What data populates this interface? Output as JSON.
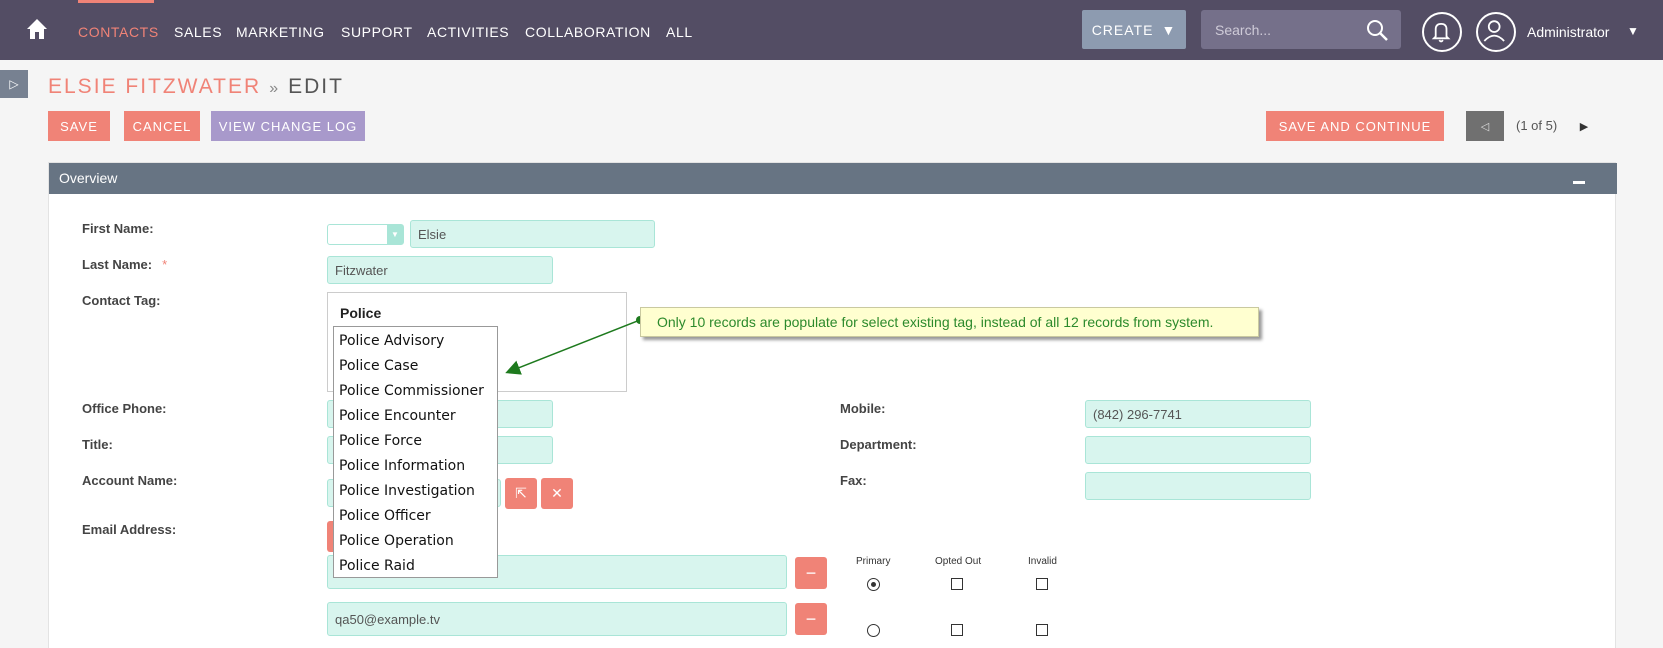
{
  "nav": {
    "items": [
      "CONTACTS",
      "SALES",
      "MARKETING",
      "SUPPORT",
      "ACTIVITIES",
      "COLLABORATION",
      "ALL"
    ],
    "create_label": "CREATE",
    "search_placeholder": "Search...",
    "user_name": "Administrator"
  },
  "breadcrumb": {
    "record": "ELSIE FITZWATER",
    "separator": "»",
    "action": "EDIT"
  },
  "toolbar": {
    "save": "SAVE",
    "cancel": "CANCEL",
    "view_change_log": "VIEW CHANGE LOG",
    "save_and_continue": "SAVE AND CONTINUE",
    "pager_text": "(1 of 5)"
  },
  "panel": {
    "title": "Overview"
  },
  "form": {
    "first_name_label": "First Name:",
    "first_name_value": "Elsie",
    "last_name_label": "Last Name:",
    "required_mark": "*",
    "last_name_value": "Fitzwater",
    "contact_tag_label": "Contact Tag:",
    "contact_tag_input": "Police",
    "office_phone_label": "Office Phone:",
    "title_label": "Title:",
    "account_name_label": "Account Name:",
    "email_label": "Email Address:",
    "mobile_label": "Mobile:",
    "mobile_value": "(842) 296-7741",
    "department_label": "Department:",
    "fax_label": "Fax:",
    "email2_value": "qa50@example.tv",
    "email_columns": [
      "Primary",
      "Opted Out",
      "Invalid"
    ]
  },
  "tag_dropdown": [
    "Police Advisory",
    "Police Case",
    "Police Commissioner",
    "Police Encounter",
    "Police Force",
    "Police Information",
    "Police Investigation",
    "Police Officer",
    "Police Operation",
    "Police Raid"
  ],
  "annotation": "Only 10 records are populate for select existing tag, instead of all 12 records from system.",
  "colors": {
    "nav_bg": "#534d64",
    "accent": "#f08377",
    "field_bg": "#d8f5ee",
    "panel_header": "#677483"
  }
}
